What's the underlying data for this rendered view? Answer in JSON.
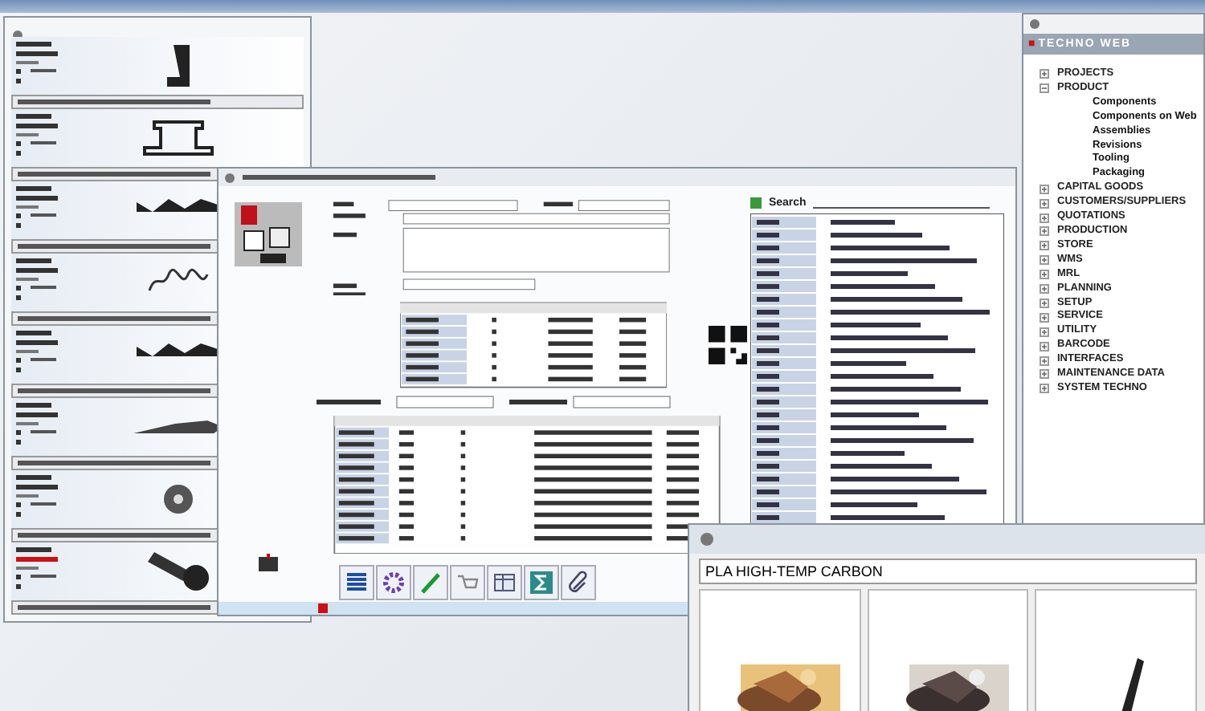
{
  "parts_panel": {
    "cards": [
      {
        "kind": "bracket",
        "flagged": false
      },
      {
        "kind": "fitting",
        "flagged": false
      },
      {
        "kind": "clip",
        "flagged": false
      },
      {
        "kind": "chain",
        "flagged": false
      },
      {
        "kind": "clip",
        "flagged": false
      },
      {
        "kind": "profile",
        "flagged": false
      },
      {
        "kind": "nut",
        "flagged": false
      },
      {
        "kind": "bolt",
        "flagged": true
      }
    ]
  },
  "list_panel": {
    "search_label": "Search"
  },
  "tree": {
    "title_mark": "■",
    "title": "TECHNO WEB",
    "items": [
      {
        "label": "PROJECTS",
        "expanded": false
      },
      {
        "label": "PRODUCT",
        "expanded": true,
        "children": [
          {
            "label": "Components"
          },
          {
            "label": "Components on Web"
          },
          {
            "label": "Assemblies"
          },
          {
            "label": "Revisions"
          },
          {
            "label": "Tooling"
          },
          {
            "label": "Packaging"
          }
        ]
      },
      {
        "label": "CAPITAL GOODS",
        "expanded": false
      },
      {
        "label": "CUSTOMERS/SUPPLIERS",
        "expanded": false
      },
      {
        "label": "QUOTATIONS",
        "expanded": false
      },
      {
        "label": "PRODUCTION",
        "expanded": false
      },
      {
        "label": "STORE",
        "expanded": false
      },
      {
        "label": "WMS",
        "expanded": false
      },
      {
        "label": "MRL",
        "expanded": false
      },
      {
        "label": "PLANNING",
        "expanded": false
      },
      {
        "label": "SETUP",
        "expanded": false
      },
      {
        "label": "SERVICE",
        "expanded": false
      },
      {
        "label": "UTILITY",
        "expanded": false
      },
      {
        "label": "BARCODE",
        "expanded": false
      },
      {
        "label": "INTERFACES",
        "expanded": false
      },
      {
        "label": "MAINTENANCE DATA",
        "expanded": false
      },
      {
        "label": "SYSTEM TECHNO",
        "expanded": false
      }
    ]
  },
  "material_window": {
    "field_value": "PLA HIGH-TEMP CARBON",
    "tiles": [
      {
        "kind": "picture"
      },
      {
        "kind": "picture"
      },
      {
        "kind": "part"
      }
    ]
  }
}
